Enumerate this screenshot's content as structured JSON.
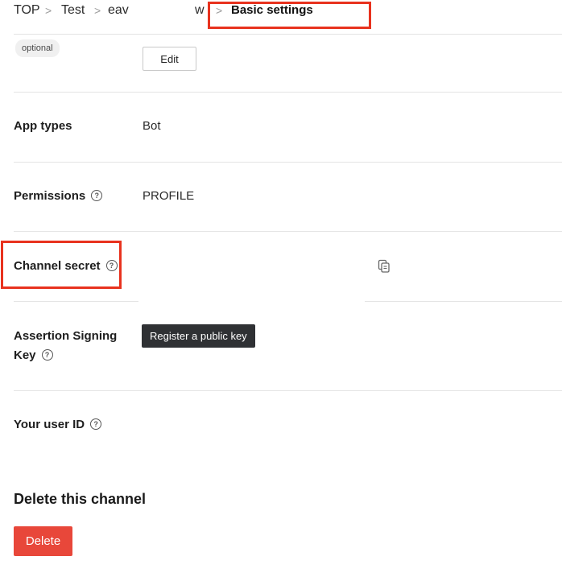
{
  "breadcrumb": {
    "items": [
      "TOP",
      "Test",
      "eav",
      "w"
    ],
    "separator": ">",
    "current": "Basic settings"
  },
  "top_row": {
    "badge": "optional",
    "edit_label": "Edit"
  },
  "rows": {
    "app_types": {
      "label": "App types",
      "value": "Bot"
    },
    "permissions": {
      "label": "Permissions",
      "value": "PROFILE"
    },
    "channel_secret": {
      "label": "Channel secret"
    },
    "assertion_key": {
      "label_line1": "Assertion Signing",
      "label_line2": "Key",
      "button_label": "Register a public key"
    },
    "user_id": {
      "label": "Your user ID"
    }
  },
  "delete_section": {
    "title": "Delete this channel",
    "button_label": "Delete"
  },
  "colors": {
    "highlight": "#e8321e",
    "delete_button": "#e8473a",
    "dark_button": "#2f3134"
  },
  "icons": {
    "help": "?",
    "copy": "copy-icon"
  }
}
